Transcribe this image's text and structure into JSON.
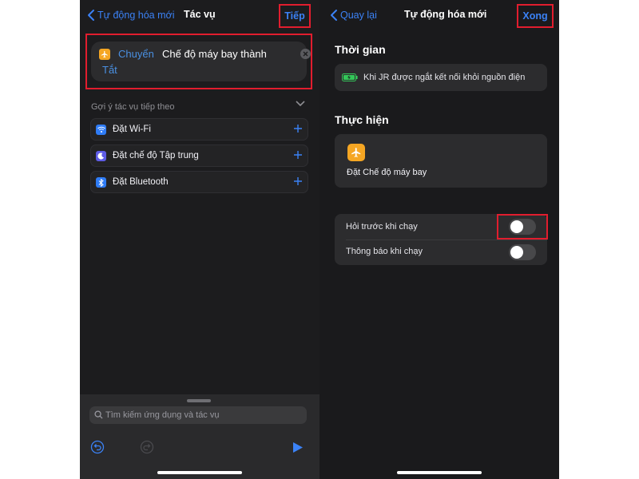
{
  "left_screen": {
    "back_label": "Tự động hóa mới",
    "title": "Tác vụ",
    "next_label": "Tiếp",
    "action": {
      "verb": "Chuyển",
      "text": "Chế độ máy bay thành",
      "state": "Tắt"
    },
    "suggestions_header": "Gợi ý tác vụ tiếp theo",
    "suggestions": [
      {
        "label": "Đặt Wi-Fi",
        "icon": "wifi-icon",
        "color": "#2f7cf6"
      },
      {
        "label": "Đặt chế độ Tập trung",
        "icon": "moon-icon",
        "color": "#5e5ce6"
      },
      {
        "label": "Đặt Bluetooth",
        "icon": "bluetooth-icon",
        "color": "#2f7cf6"
      }
    ],
    "search_placeholder": "Tìm kiếm ứng dụng và tác vụ"
  },
  "right_screen": {
    "back_label": "Quay lại",
    "title": "Tự động hóa mới",
    "done_label": "Xong",
    "when_header": "Thời gian",
    "trigger_text": "Khi JR được ngắt kết nối khỏi nguồn điện",
    "do_header": "Thực hiện",
    "do_action": "Đặt Chế độ máy bay",
    "settings": [
      {
        "label": "Hỏi trước khi chạy",
        "on": false
      },
      {
        "label": "Thông báo khi chạy",
        "on": false
      }
    ]
  },
  "colors": {
    "accent": "#3b82f6",
    "highlight": "#e11d2e",
    "airplane": "#f5a623",
    "battery": "#34c759"
  }
}
